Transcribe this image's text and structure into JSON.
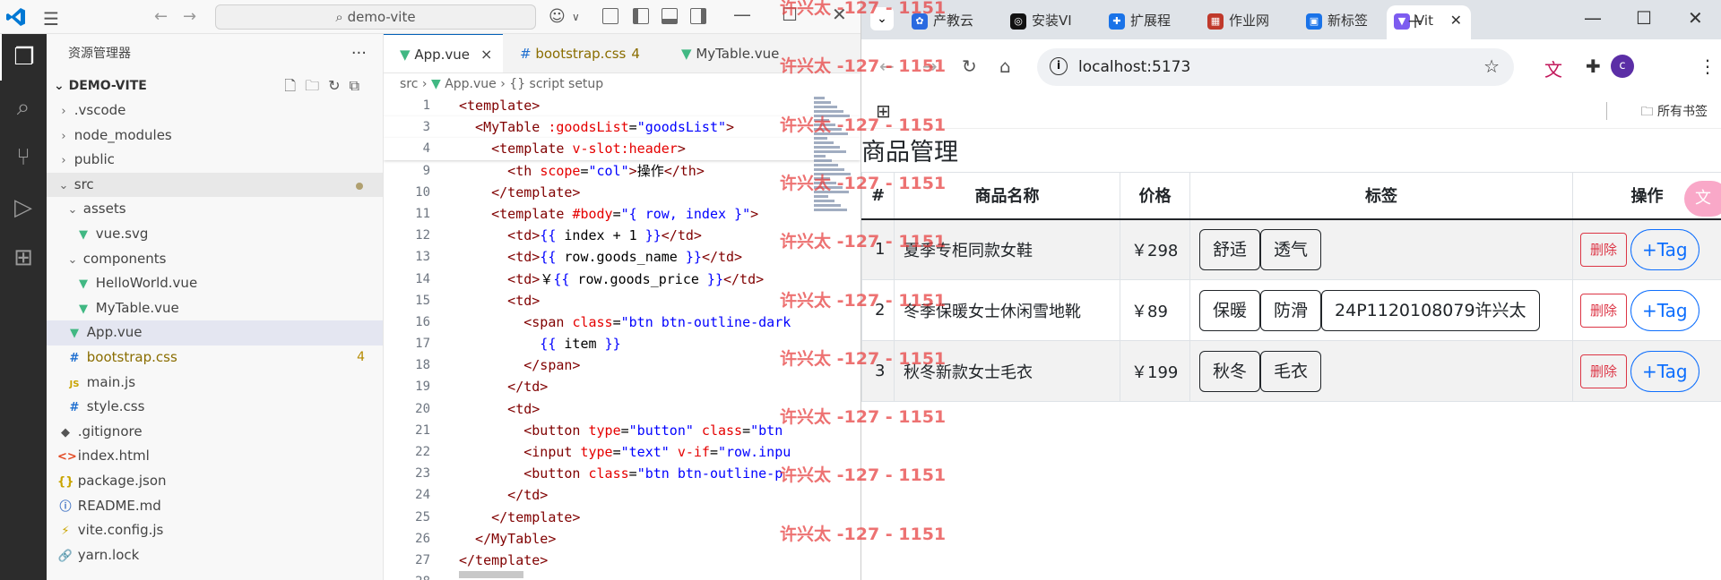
{
  "vscode": {
    "search_text": "demo-vite",
    "explorer_title": "资源管理器",
    "more": "···",
    "project_name": "DEMO-VITE",
    "tree": [
      {
        "label": ".vscode",
        "type": "folder",
        "indent": 0,
        "open": false
      },
      {
        "label": "node_modules",
        "type": "folder",
        "indent": 0,
        "open": false
      },
      {
        "label": "public",
        "type": "folder",
        "indent": 0,
        "open": false
      },
      {
        "label": "src",
        "type": "folder",
        "indent": 0,
        "open": true,
        "modified": true
      },
      {
        "label": "assets",
        "type": "folder",
        "indent": 1,
        "open": true
      },
      {
        "label": "vue.svg",
        "type": "vue",
        "indent": 2
      },
      {
        "label": "components",
        "type": "folder",
        "indent": 1,
        "open": true
      },
      {
        "label": "HelloWorld.vue",
        "type": "vue",
        "indent": 2
      },
      {
        "label": "MyTable.vue",
        "type": "vue",
        "indent": 2
      },
      {
        "label": "App.vue",
        "type": "vue",
        "indent": 1,
        "selected": true
      },
      {
        "label": "bootstrap.css",
        "type": "css",
        "indent": 1,
        "badge": "4"
      },
      {
        "label": "main.js",
        "type": "js",
        "indent": 1
      },
      {
        "label": "style.css",
        "type": "css",
        "indent": 1
      },
      {
        "label": ".gitignore",
        "type": "git",
        "indent": 0
      },
      {
        "label": "index.html",
        "type": "html",
        "indent": 0
      },
      {
        "label": "package.json",
        "type": "json",
        "indent": 0
      },
      {
        "label": "README.md",
        "type": "md",
        "indent": 0
      },
      {
        "label": "vite.config.js",
        "type": "vite",
        "indent": 0
      },
      {
        "label": "yarn.lock",
        "type": "lock",
        "indent": 0
      }
    ],
    "tabs": [
      {
        "label": "App.vue",
        "kind": "vue",
        "active": true,
        "close": "×"
      },
      {
        "label": "bootstrap.css",
        "kind": "css",
        "badge": "4"
      },
      {
        "label": "MyTable.vue",
        "kind": "vue"
      }
    ],
    "breadcrumbs": [
      "src",
      "App.vue",
      "{} script setup"
    ],
    "code": [
      {
        "n": "1",
        "sticky": true,
        "parts": [
          [
            "tag",
            "<template>"
          ]
        ]
      },
      {
        "n": "3",
        "sticky": true,
        "parts": [
          [
            "tag",
            "  <MyTable "
          ],
          [
            "attr",
            ":goodsList"
          ],
          [
            "txt",
            "="
          ],
          [
            "str",
            "\"goodsList\""
          ],
          [
            "tag",
            ">"
          ]
        ]
      },
      {
        "n": "4",
        "sticky": true,
        "parts": [
          [
            "tag",
            "    <template "
          ],
          [
            "attr",
            "v-slot:header"
          ],
          [
            "tag",
            ">"
          ]
        ]
      },
      {
        "n": "9",
        "parts": [
          [
            "tag",
            "      <th "
          ],
          [
            "attr",
            "scope"
          ],
          [
            "txt",
            "="
          ],
          [
            "str",
            "\"col\""
          ],
          [
            "tag",
            ">"
          ],
          [
            "txt",
            "操作"
          ],
          [
            "tag",
            "</th>"
          ]
        ]
      },
      {
        "n": "10",
        "parts": [
          [
            "tag",
            "    </template>"
          ]
        ]
      },
      {
        "n": "11",
        "parts": [
          [
            "tag",
            "    <template "
          ],
          [
            "attr",
            "#body"
          ],
          [
            "txt",
            "="
          ],
          [
            "str",
            "\"{ row, index }\""
          ],
          [
            "tag",
            ">"
          ]
        ]
      },
      {
        "n": "12",
        "parts": [
          [
            "tag",
            "      <td>"
          ],
          [
            "br",
            "{{"
          ],
          [
            "txt",
            " index + 1 "
          ],
          [
            "br",
            "}}"
          ],
          [
            "tag",
            "</td>"
          ]
        ]
      },
      {
        "n": "13",
        "parts": [
          [
            "tag",
            "      <td>"
          ],
          [
            "br",
            "{{"
          ],
          [
            "txt",
            " row.goods_name "
          ],
          [
            "br",
            "}}"
          ],
          [
            "tag",
            "</td>"
          ]
        ]
      },
      {
        "n": "14",
        "parts": [
          [
            "tag",
            "      <td>"
          ],
          [
            "txt",
            "￥"
          ],
          [
            "br",
            "{{"
          ],
          [
            "txt",
            " row.goods_price "
          ],
          [
            "br",
            "}}"
          ],
          [
            "tag",
            "</td>"
          ]
        ]
      },
      {
        "n": "15",
        "parts": [
          [
            "tag",
            "      <td>"
          ]
        ]
      },
      {
        "n": "16",
        "parts": [
          [
            "tag",
            "        <span "
          ],
          [
            "attr",
            "class"
          ],
          [
            "txt",
            "="
          ],
          [
            "str",
            "\"btn btn-outline-dark"
          ]
        ]
      },
      {
        "n": "17",
        "parts": [
          [
            "br",
            "          {{"
          ],
          [
            "txt",
            " item "
          ],
          [
            "br",
            "}}"
          ]
        ]
      },
      {
        "n": "18",
        "parts": [
          [
            "tag",
            "        </span>"
          ]
        ]
      },
      {
        "n": "19",
        "parts": [
          [
            "tag",
            "      </td>"
          ]
        ]
      },
      {
        "n": "20",
        "parts": [
          [
            "tag",
            "      <td>"
          ]
        ]
      },
      {
        "n": "21",
        "parts": [
          [
            "tag",
            "        <button "
          ],
          [
            "attr",
            "type"
          ],
          [
            "txt",
            "="
          ],
          [
            "str",
            "\"button\""
          ],
          [
            "attr",
            " class"
          ],
          [
            "txt",
            "="
          ],
          [
            "str",
            "\"btn"
          ]
        ]
      },
      {
        "n": "22",
        "parts": [
          [
            "tag",
            "        <input "
          ],
          [
            "attr",
            "type"
          ],
          [
            "txt",
            "="
          ],
          [
            "str",
            "\"text\""
          ],
          [
            "attr",
            " v-if"
          ],
          [
            "txt",
            "="
          ],
          [
            "str",
            "\"row.inpu"
          ]
        ]
      },
      {
        "n": "23",
        "parts": [
          [
            "tag",
            "        <button "
          ],
          [
            "attr",
            "class"
          ],
          [
            "txt",
            "="
          ],
          [
            "str",
            "\"btn btn-outline-p"
          ]
        ]
      },
      {
        "n": "24",
        "parts": [
          [
            "tag",
            "      </td>"
          ]
        ]
      },
      {
        "n": "25",
        "parts": [
          [
            "tag",
            "    </template>"
          ]
        ]
      },
      {
        "n": "26",
        "parts": [
          [
            "tag",
            "  </MyTable>"
          ]
        ]
      },
      {
        "n": "27",
        "parts": [
          [
            "tag",
            "</template>"
          ]
        ]
      },
      {
        "n": "28",
        "parts": []
      }
    ]
  },
  "chrome": {
    "tabs": [
      {
        "label": "产教云",
        "icon_color": "#2a6ae0",
        "icon_glyph": "✿"
      },
      {
        "label": "安装VI",
        "icon_color": "#111111",
        "icon_glyph": "◎"
      },
      {
        "label": "扩展程",
        "icon_color": "#1a73e8",
        "icon_glyph": "✚"
      },
      {
        "label": "作业网",
        "icon_color": "#c0392b",
        "icon_glyph": "▦"
      },
      {
        "label": "新标签",
        "icon_color": "#1a73e8",
        "icon_glyph": "▣"
      },
      {
        "label": "Vit",
        "icon_color": "#7d5cf0",
        "icon_glyph": "▼",
        "active": true
      }
    ],
    "url": "localhost:5173",
    "all_bookmarks": "所有书签",
    "avatar_letter": "c",
    "page": {
      "title": "商品管理",
      "headers": [
        "#",
        "商品名称",
        "价格",
        "标签",
        "操作"
      ],
      "rows": [
        {
          "num": "1",
          "name": "夏季专柜同款女鞋",
          "price": "￥298",
          "tags": [
            "舒适",
            "透气"
          ]
        },
        {
          "num": "2",
          "name": "冬季保暖女士休闲雪地靴",
          "price": "￥89",
          "tags": [
            "保暖",
            "防滑",
            "24P1120108079许兴太"
          ]
        },
        {
          "num": "3",
          "name": "秋冬新款女士毛衣",
          "price": "￥199",
          "tags": [
            "秋冬",
            "毛衣"
          ]
        }
      ],
      "delete_label": "删除",
      "add_tag_label": "+Tag"
    }
  },
  "watermark": "许兴太 -127 - 1151",
  "watermark_count": 10
}
